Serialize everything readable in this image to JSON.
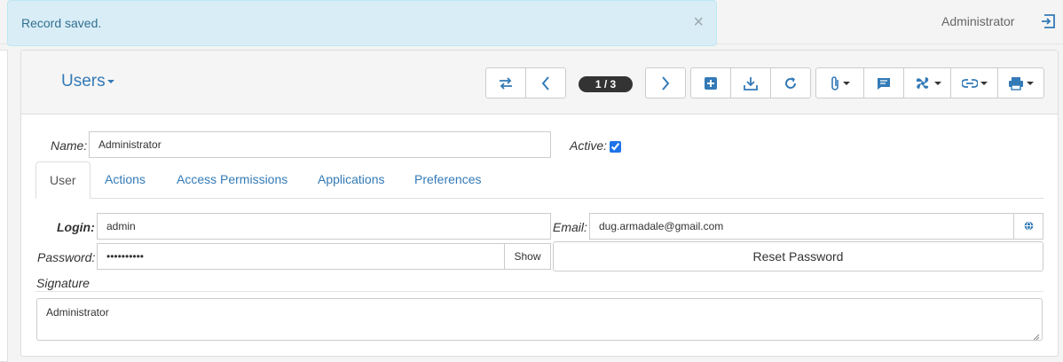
{
  "alert": {
    "message": "Record saved.",
    "close_glyph": "×"
  },
  "header": {
    "user": "Administrator",
    "logout_icon": "logout-icon"
  },
  "view": {
    "title": "Users",
    "pager": "1 / 3"
  },
  "toolbar": {
    "icons": [
      "switch-view-icon",
      "previous-icon",
      "next-icon",
      "new-record-icon",
      "save-icon",
      "refresh-icon",
      "attachment-icon",
      "comment-icon",
      "actions-fan-icon",
      "link-icon",
      "print-icon"
    ]
  },
  "form": {
    "name_label": "Name:",
    "name_value": "Administrator",
    "active_label": "Active:",
    "active": true
  },
  "tabs": [
    "User",
    "Actions",
    "Access Permissions",
    "Applications",
    "Preferences"
  ],
  "user_tab": {
    "login_label": "Login:",
    "login_value": "admin",
    "email_label": "Email:",
    "email_value": "dug.armadale@gmail.com",
    "password_label": "Password:",
    "password_value": "••••••••••",
    "show_label": "Show",
    "reset_label": "Reset Password",
    "signature_label": "Signature",
    "signature_value": "Administrator"
  },
  "colors": {
    "link": "#337ab7",
    "alert_bg": "#d9edf7",
    "alert_text": "#31708f",
    "pager_bg": "#333333"
  }
}
